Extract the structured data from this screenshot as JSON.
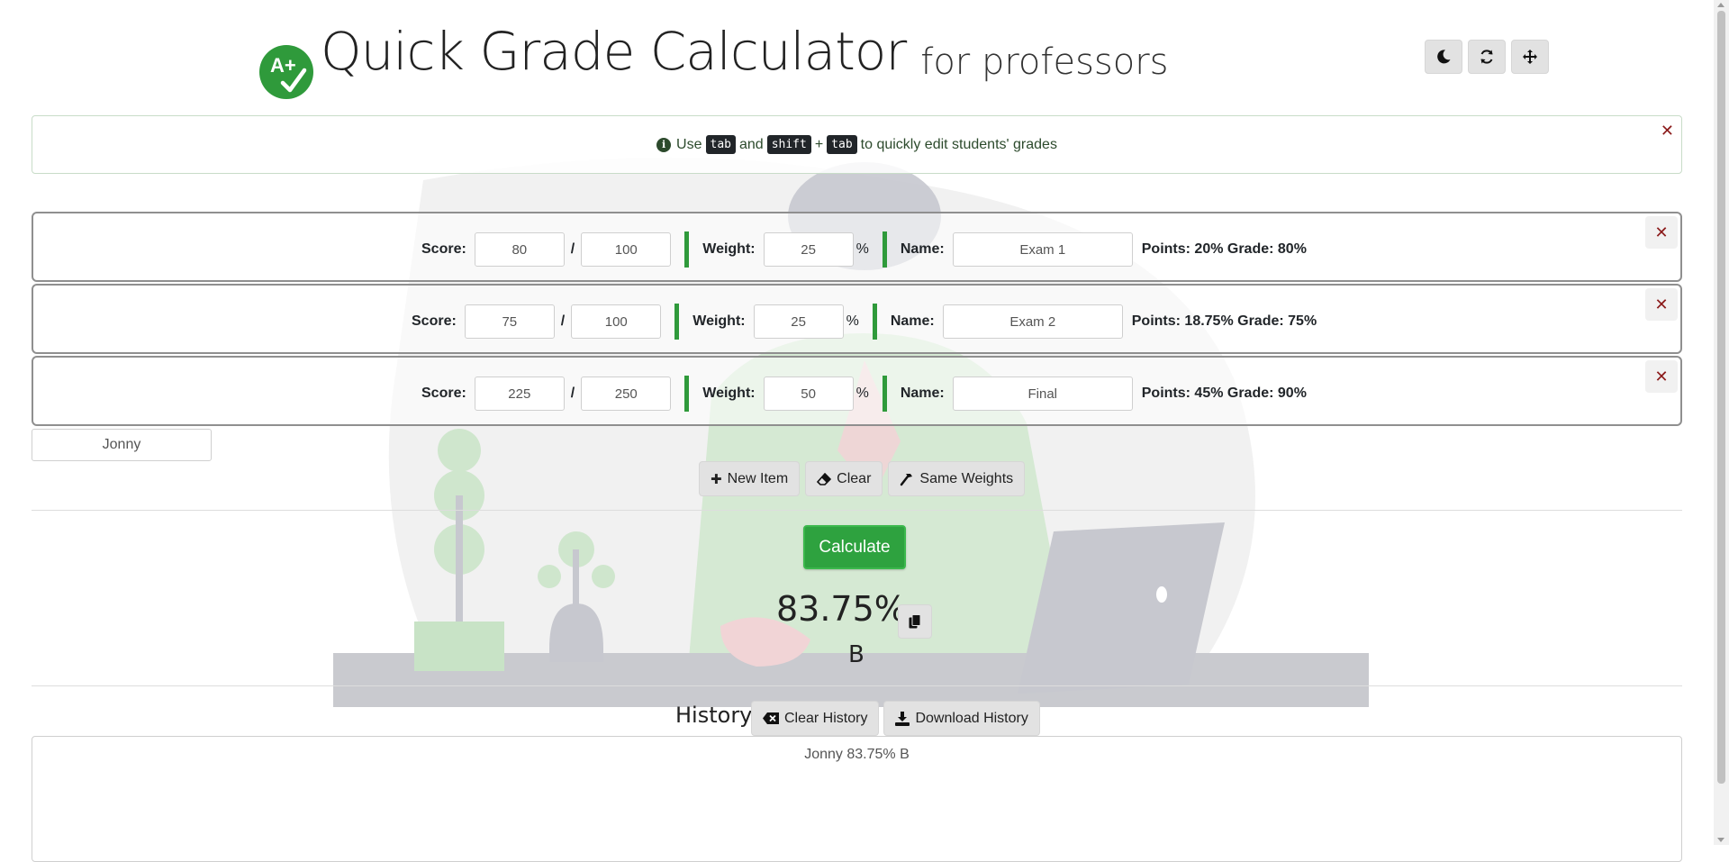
{
  "header": {
    "logo_text": "A+",
    "title": "Quick Grade Calculator",
    "subtitle": "for professors"
  },
  "top_controls": [
    {
      "name": "moon-icon",
      "label": "Toggle dark mode"
    },
    {
      "name": "refresh-icon",
      "label": "Reset"
    },
    {
      "name": "move-icon",
      "label": "Move"
    }
  ],
  "info": {
    "prefix": "Use",
    "key1": "tab",
    "and": "and",
    "key2": "shift",
    "plus": "+",
    "key3": "tab",
    "suffix": "to quickly edit students' grades"
  },
  "labels": {
    "score": "Score:",
    "slash": "/",
    "weight": "Weight:",
    "percent": "%",
    "name": "Name:"
  },
  "items": [
    {
      "score": "80",
      "total": "100",
      "weight": "25",
      "name": "Exam 1",
      "result": "Points: 20% Grade: 80%"
    },
    {
      "score": "75",
      "total": "100",
      "weight": "25",
      "name": "Exam 2",
      "result": "Points: 18.75% Grade: 75%"
    },
    {
      "score": "225",
      "total": "250",
      "weight": "50",
      "name": "Final",
      "result": "Points: 45% Grade: 90%"
    }
  ],
  "student_name": "Jonny",
  "actions": {
    "new_item": "New Item",
    "clear": "Clear",
    "same_weights": "Same Weights"
  },
  "calculate_label": "Calculate",
  "result": {
    "percent": "83.75%",
    "letter": "B"
  },
  "history": {
    "title": "History",
    "clear_label": "Clear History",
    "download_label": "Download History",
    "entries": [
      "Jonny 83.75% B"
    ]
  },
  "colors": {
    "accent": "#2ea23f",
    "close": "#8b1a1a"
  }
}
